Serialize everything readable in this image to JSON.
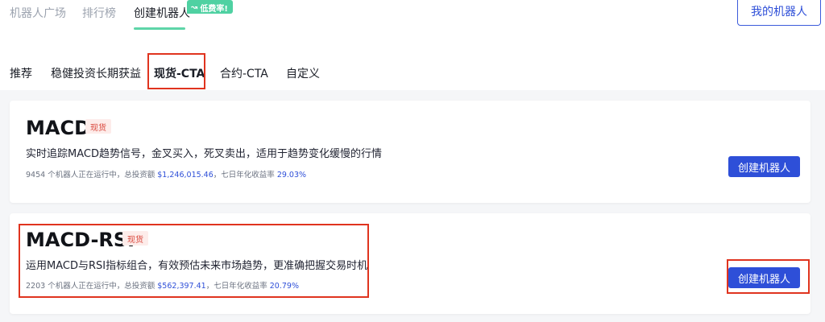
{
  "top_tabs": [
    {
      "label": "机器人广场"
    },
    {
      "label": "排行榜"
    },
    {
      "label": "创建机器人"
    }
  ],
  "fee_badge": {
    "label": "低费率!",
    "icon": "trend-arrow-icon"
  },
  "my_bots_button": "我的机器人",
  "sub_tabs": [
    {
      "label": "推荐"
    },
    {
      "label": "稳健投资长期获益"
    },
    {
      "label": "现货-CTA"
    },
    {
      "label": "合约-CTA"
    },
    {
      "label": "自定义"
    }
  ],
  "cards": [
    {
      "title": "MACD",
      "tag": "现货",
      "description": "实时追踪MACD趋势信号，金叉买入，死叉卖出，适用于趋势变化缓慢的行情",
      "running_count": "9454",
      "running_text": "个机器人正在运行中，总投资额",
      "investment": "$1,246,015.46",
      "yield_text": "，七日年化收益率",
      "yield": "29.03%",
      "button": "创建机器人"
    },
    {
      "title": "MACD-RSI",
      "tag": "现货",
      "description": "运用MACD与RSI指标组合，有效预估未来市场趋势，更准确把握交易时机",
      "running_count": "2203",
      "running_text": "个机器人正在运行中，总投资额",
      "investment": "$562,397.41",
      "yield_text": "，七日年化收益率",
      "yield": "20.79%",
      "button": "创建机器人"
    }
  ],
  "colors": {
    "accent": "#2e4fd8",
    "highlight": "#e0341f",
    "badge": "#4fd1a2",
    "tag_text": "#d9463b"
  }
}
